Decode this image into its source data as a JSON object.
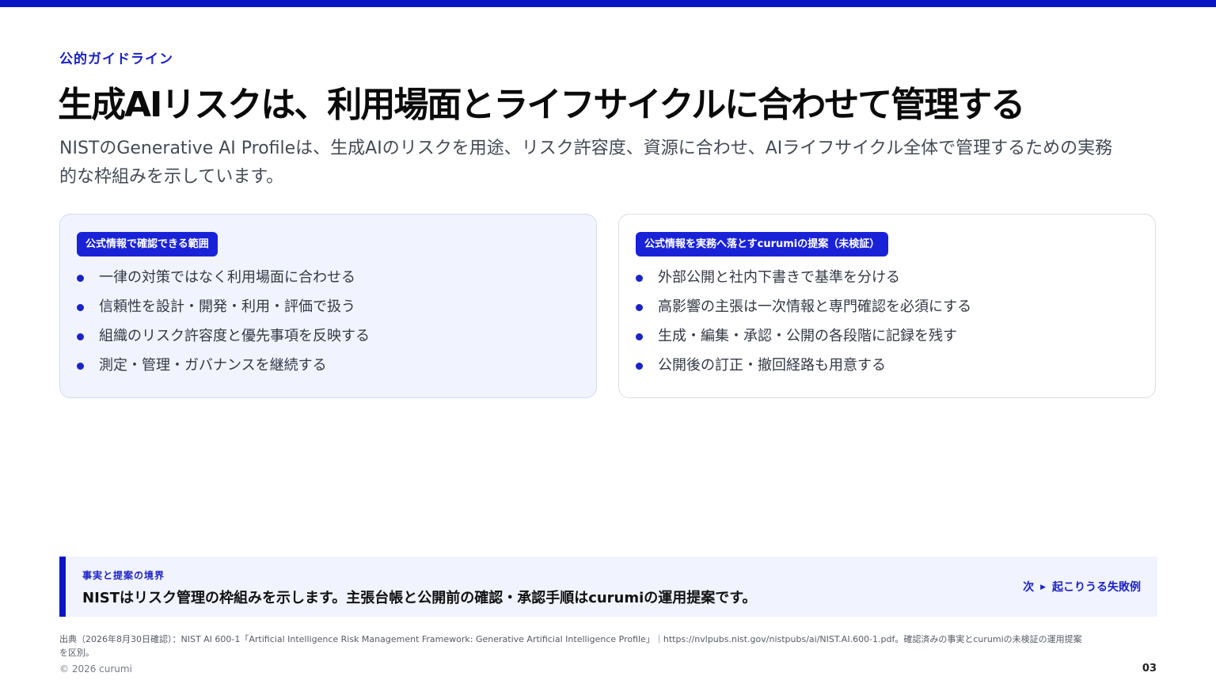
{
  "colors": {
    "accent": "#0a16c4",
    "card_left_bg": "#f1f3ff",
    "text": "#111111"
  },
  "header": {
    "eyebrow": "公的ガイドライン",
    "title": "生成AIリスクは、利用場面とライフサイクルに合わせて管理する",
    "lead": "NISTのGenerative AI Profileは、生成AIのリスクを用途、リスク許容度、資源に合わせ、AIライフサイクル全体で管理するための実務的な枠組みを示しています。"
  },
  "cards": [
    {
      "tag": "公式情報で確認できる範囲",
      "items": [
        "一律の対策ではなく利用場面に合わせる",
        "信頼性を設計・開発・利用・評価で扱う",
        "組織のリスク許容度と優先事項を反映する",
        "測定・管理・ガバナンスを継続する"
      ]
    },
    {
      "tag": "公式情報を実務へ落とすcurumiの提案（未検証）",
      "items": [
        "外部公開と社内下書きで基準を分ける",
        "高影響の主張は一次情報と専門確認を必須にする",
        "生成・編集・承認・公開の各段階に記録を残す",
        "公開後の訂正・撤回経路も用意する"
      ]
    }
  ],
  "callout": {
    "label": "事実と提案の境界",
    "text": "NISTはリスク管理の枠組みを示します。主張台帳と公開前の確認・承認手順はcurumiの運用提案です。",
    "next_prefix": "次",
    "next_label": "起こりうる失敗例"
  },
  "footer": {
    "source": "出典（2026年8月30日確認）：NIST AI 600-1「Artificial Intelligence Risk Management Framework: Generative Artificial Intelligence Profile」｜https://nvlpubs.nist.gov/nistpubs/ai/NIST.AI.600-1.pdf。確認済みの事実とcurumiの未検証の運用提案を区別。",
    "copyright": "© 2026 curumi",
    "page_number": "03"
  }
}
